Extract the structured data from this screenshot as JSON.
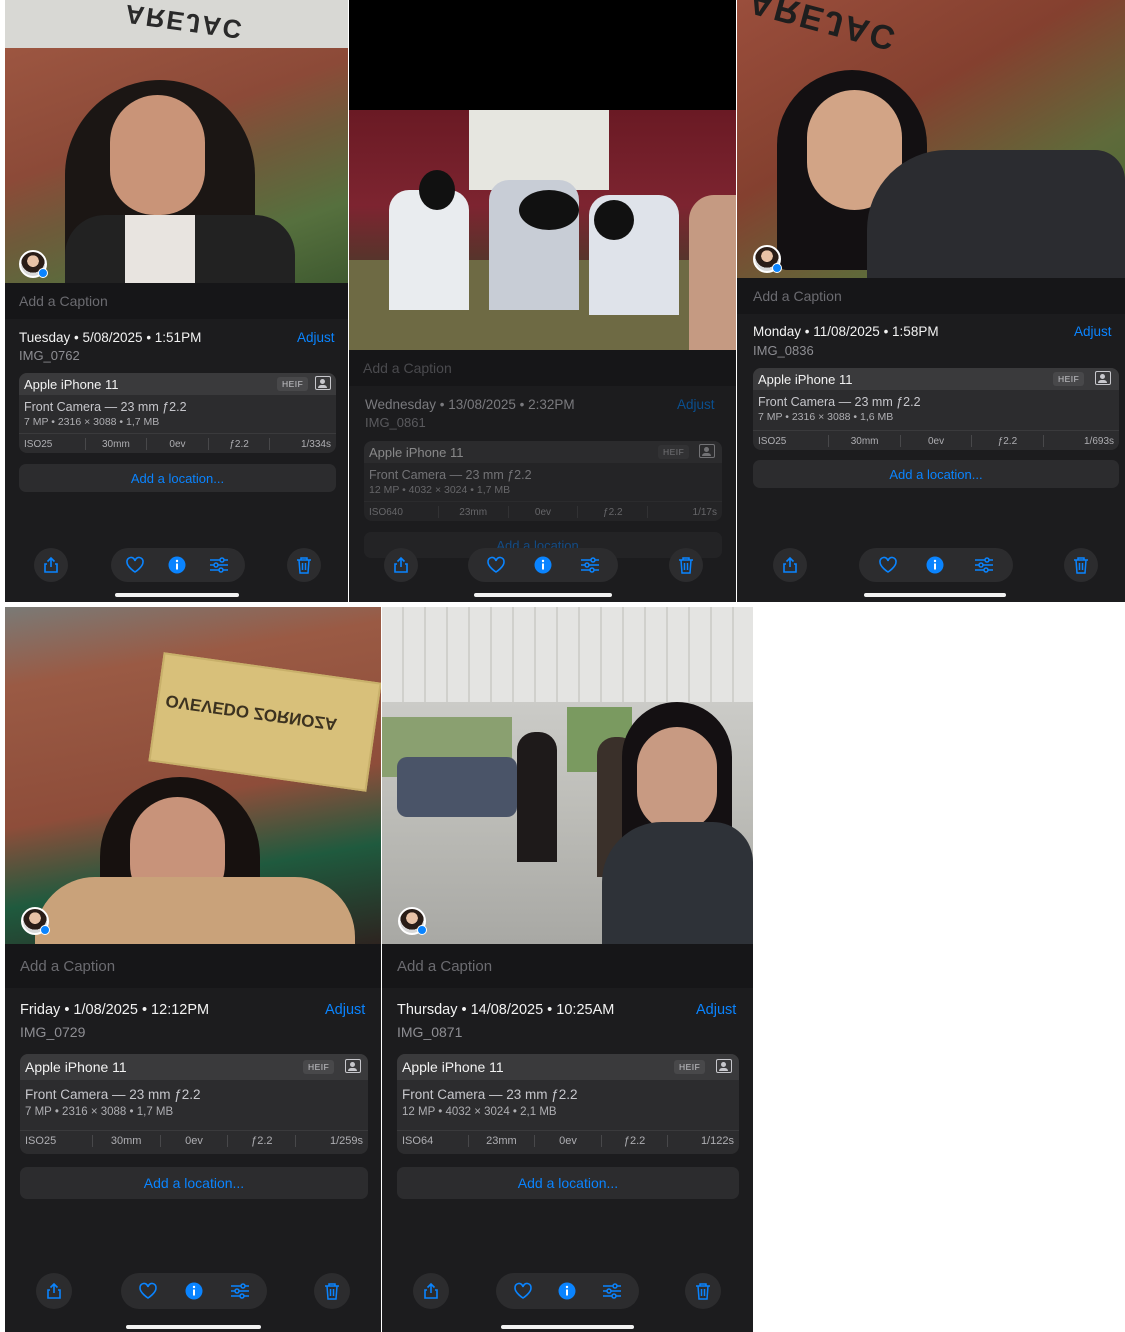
{
  "colors": {
    "accent": "#0a84ff",
    "background": "#1c1c1e",
    "card": "#2c2c2e"
  },
  "common": {
    "caption_placeholder": "Add a Caption",
    "adjust": "Adjust",
    "device": "Apple iPhone 11",
    "format": "HEIF",
    "location": "Add a location..."
  },
  "panels": [
    {
      "date": "Tuesday • 5/08/2025 • 1:51PM",
      "filename": "IMG_0762",
      "lens": "Front Camera — 23 mm ƒ2.2",
      "specs": "7 MP • 2316 × 3088 • 1,7 MB",
      "exif": [
        "ISO25",
        "30mm",
        "0ev",
        "ƒ2.2",
        "1/334s"
      ],
      "sign": "COLEGIO CONSAGRADO LA CALERA"
    },
    {
      "date": "Wednesday • 13/08/2025 • 2:32PM",
      "filename": "IMG_0861",
      "lens": "Front Camera — 23 mm ƒ2.2",
      "specs": "12 MP • 4032 × 3024 • 1,7 MB",
      "exif": [
        "ISO640",
        "23mm",
        "0ev",
        "ƒ2.2",
        "1/17s"
      ]
    },
    {
      "date": "Monday • 11/08/2025 • 1:58PM",
      "filename": "IMG_0836",
      "lens": "Front Camera — 23 mm ƒ2.2",
      "specs": "7 MP • 2316 × 3088 • 1,6 MB",
      "exif": [
        "ISO25",
        "30mm",
        "0ev",
        "ƒ2.2",
        "1/693s"
      ],
      "sign": "CONSAGRADO LA CALERA"
    },
    {
      "date": "Friday • 1/08/2025 • 12:12PM",
      "filename": "IMG_0729",
      "lens": "Front Camera — 23 mm ƒ2.2",
      "specs": "7 MP • 2316 × 3088 • 1,7 MB",
      "exif": [
        "ISO25",
        "30mm",
        "0ev",
        "ƒ2.2",
        "1/259s"
      ],
      "sign": "GUILLERMO QUEVEDO ZORNOZA"
    },
    {
      "date": "Thursday • 14/08/2025 • 10:25AM",
      "filename": "IMG_0871",
      "lens": "Front Camera — 23 mm ƒ2.2",
      "specs": "12 MP • 4032 × 3024 • 2,1 MB",
      "exif": [
        "ISO64",
        "23mm",
        "0ev",
        "ƒ2.2",
        "1/122s"
      ]
    }
  ]
}
